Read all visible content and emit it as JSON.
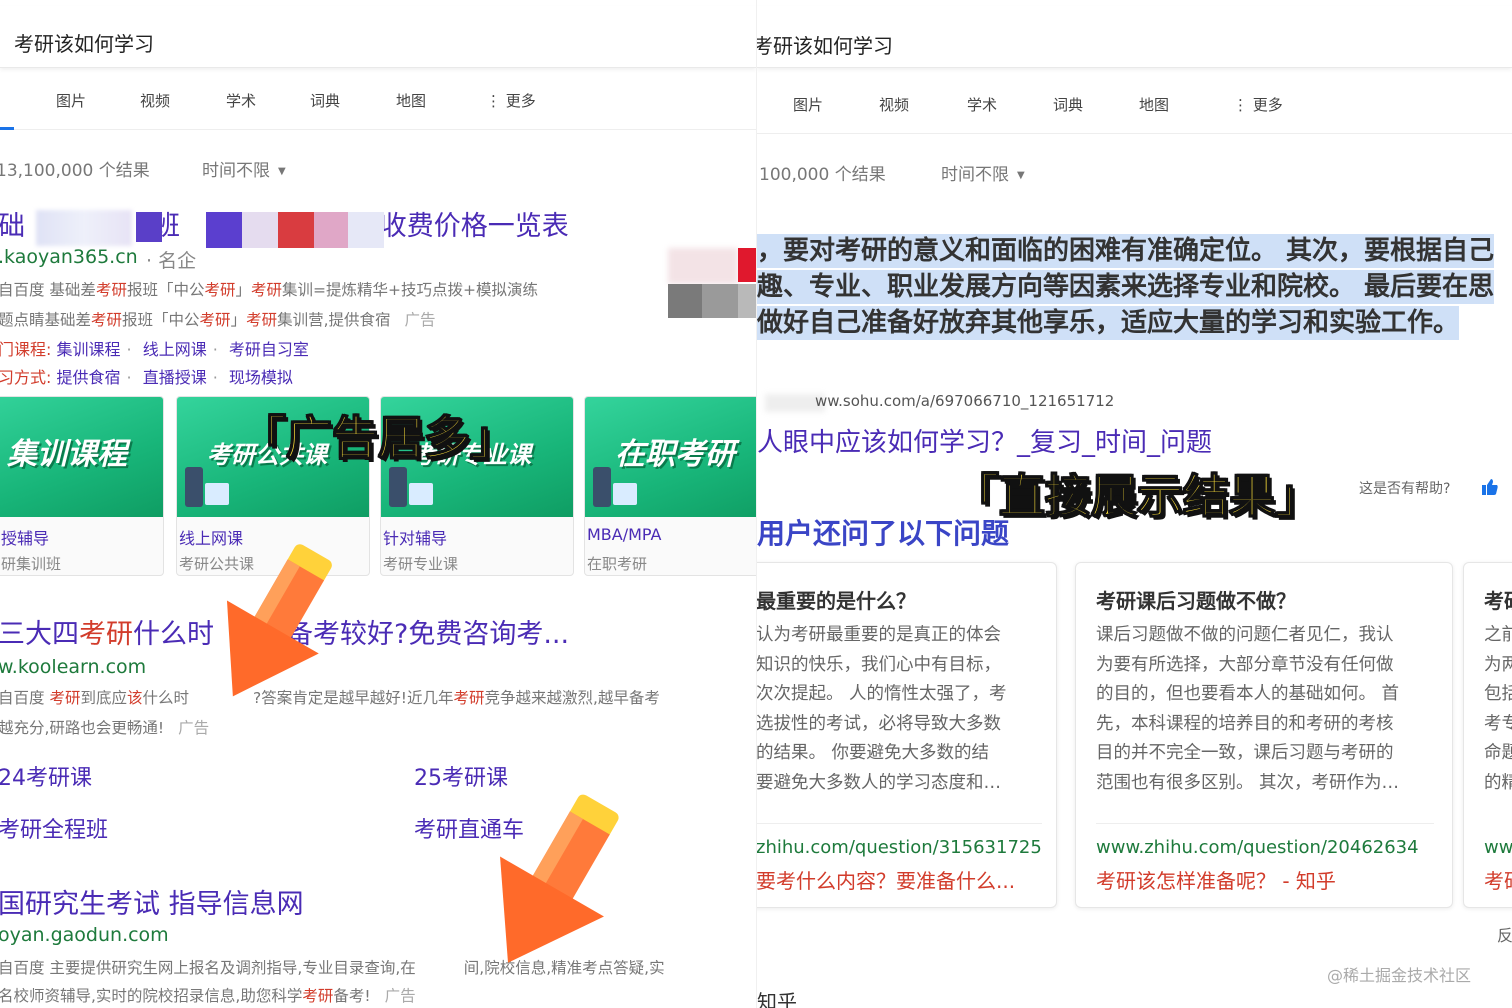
{
  "left": {
    "query": "考研该如何学习",
    "tabs": [
      "图片",
      "视频",
      "学术",
      "词典",
      "地图",
      "更多"
    ],
    "results_count": "13,100,000 个结果",
    "time_filter": "时间不限",
    "ad1": {
      "title_prefix": "础",
      "title_mid": "班",
      "title_suffix": "-收费价格一览表",
      "url": ".kaoyan365.cn",
      "url_suffix": "· 名企",
      "snip1_a": "自百度 基础差",
      "snip1_b": "考研",
      "snip1_c": "报班「中公",
      "snip1_d": "考研",
      "snip1_e": "」",
      "snip1_f": "考研",
      "snip1_g": "集训=提炼精华+技巧点拨+模拟演练",
      "snip2_a": "题点睛基础差",
      "snip2_b": "考研",
      "snip2_c": "报班「中公",
      "snip2_d": "考研",
      "snip2_e": "」",
      "snip2_f": "考研",
      "snip2_g": "集训营,提供食宿",
      "ad_label": "广告",
      "row1_label": "门课程:",
      "row1_links": [
        "集训课程",
        "线上网课",
        "考研自习室"
      ],
      "row2_label": "习方式:",
      "row2_links": [
        "提供食宿",
        "直播授课",
        "现场模拟"
      ]
    },
    "cards": [
      {
        "img_text": "集训课程",
        "line1": "授辅导",
        "line2": "研集训班"
      },
      {
        "img_text": "考研公共课",
        "line1": "线上网课",
        "line2": "考研公共课"
      },
      {
        "img_text": "考研专业课",
        "line1": "针对辅导",
        "line2": "考研专业课"
      },
      {
        "img_text": "在职考研",
        "line1": "MBA/MPA",
        "line2": "在职考研"
      }
    ],
    "banner": "「广告居多」",
    "ad2": {
      "title_a": "三大四",
      "title_b": "考研",
      "title_c": "什么时",
      "title_d": "备考较好?免费咨询考...",
      "url": "w.koolearn.com",
      "snip1_a": "自百度 ",
      "snip1_b": "考研",
      "snip1_c": "到底应",
      "snip1_d": "该",
      "snip1_e": "什么时",
      "snip1_f": "?答案肯定是越早越好!近几年",
      "snip1_g": "考研",
      "snip1_h": "竞争越来越激烈,越早备考",
      "snip2": "越充分,研路也会更畅通!",
      "ad_label": "广告",
      "links": [
        "24考研课",
        "25考研课",
        "考研全程班",
        "考研直通车"
      ]
    },
    "ad3": {
      "title": "国研究生考试 指导信息网",
      "url": "oyan.gaodun.com",
      "snip1": "自百度 主要提供研究生网上报名及调剂指导,专业目录查询,在",
      "snip1_b": "间,院校信息,精准考点答疑,实",
      "snip2_a": "名校师资辅导,实时的院校招录信息,助您科学",
      "snip2_b": "考研",
      "snip2_c": "备考!",
      "ad_label": "广告"
    }
  },
  "right": {
    "query": "考研该如何学习",
    "tabs": [
      "图片",
      "视频",
      "学术",
      "词典",
      "地图",
      "更多"
    ],
    "results_count": "100,000 个结果",
    "time_filter": "时间不限",
    "answer_lines": [
      "，要对考研的意义和面临的困难有准确定位。 其次，要根据自己",
      "趣、专业、职业发展方向等因素来选择专业和院校。 最后要在思",
      "做好自己准备好放弃其他享乐，适应大量的学习和实验工作。"
    ],
    "ref_url": "ww.sohu.com/a/697066710_121651712",
    "ref_title": "人眼中应该如何学习？_复习_时间_问题",
    "helpful": "这是否有帮助?",
    "banner": "「直接展示结果」",
    "paa_heading": "用户还问了以下问题",
    "questions": [
      {
        "title": "最重要的是什么？",
        "body": [
          "认为考研最重要的是真正的体会",
          "知识的快乐，我们心中有目标，",
          "次次提起。 人的惰性太强了，考",
          "选拔性的考试，必将导致大多数",
          "的结果。 你要避免大多数的结",
          "要避免大多数人的学习态度和…"
        ],
        "url": "zhihu.com/question/315631725",
        "link": "要考什么内容？要准备什么..."
      },
      {
        "title": "考研课后习题做不做？",
        "body": [
          "课后习题做不做的问题仁者见仁，我认",
          "为要有所选择，大部分章节没有任何做",
          "的目的，但也要看本人的基础如何。 首",
          "先，本科课程的培养目的和考研的考核",
          "目的并不完全一致，课后习题与考研的",
          "范围也有很多区别。 其次，考研作为…"
        ],
        "url": "www.zhihu.com/question/20462634",
        "link": "考研该怎样准备呢？ - 知乎"
      },
      {
        "title": "考研",
        "body": [
          "之前",
          "为两",
          "包括",
          "考专",
          "命题",
          "的精"
        ],
        "url": "www",
        "link": "考研"
      }
    ],
    "feedback": "反",
    "bottom_cut": "知乎",
    "watermark": "@稀土掘金技术社区"
  }
}
